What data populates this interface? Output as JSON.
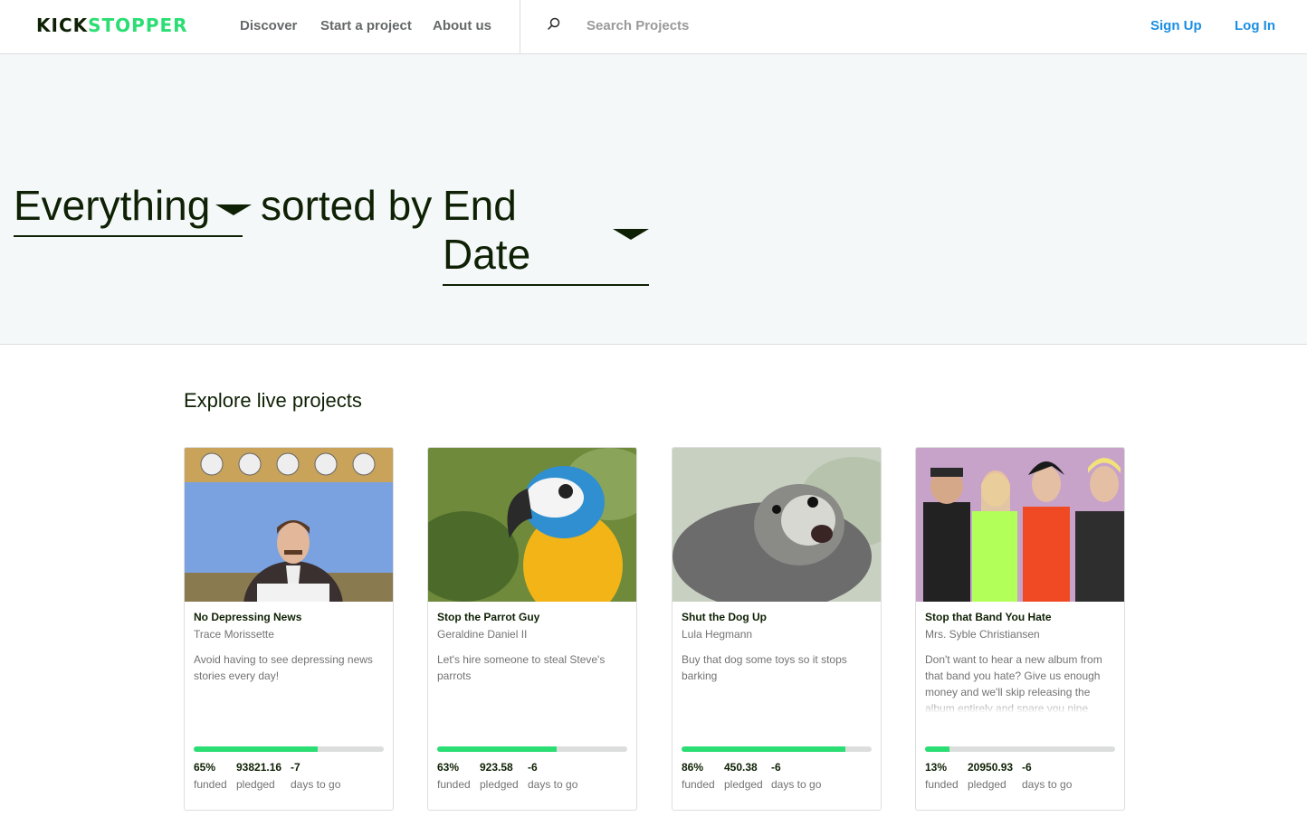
{
  "header": {
    "logo_part1": "KICK",
    "logo_part2": "STOPPER",
    "nav": [
      "Discover",
      "Start a project",
      "About us"
    ],
    "search_placeholder": "Search Projects",
    "sign_up": "Sign Up",
    "log_in": "Log In"
  },
  "hero": {
    "category": "Everything",
    "middle_text": "sorted by",
    "sort": "End Date"
  },
  "section_title": "Explore live projects",
  "projects": [
    {
      "title": "No Depressing News",
      "creator": "Trace Morissette",
      "description": "Avoid having to see depressing news stories every day!",
      "funded_percent": 65,
      "funded": "65%",
      "funded_label": "funded",
      "pledged": "93821.16",
      "pledged_label": "pledged",
      "days": "-7",
      "days_label": "days to go",
      "image_icon": "news-anchor-photo"
    },
    {
      "title": "Stop the Parrot Guy",
      "creator": "Geraldine Daniel II",
      "description": "Let's hire someone to steal Steve's parrots",
      "funded_percent": 63,
      "funded": "63%",
      "funded_label": "funded",
      "pledged": "923.58",
      "pledged_label": "pledged",
      "days": "-6",
      "days_label": "days to go",
      "image_icon": "parrot-photo"
    },
    {
      "title": "Shut the Dog Up",
      "creator": "Lula Hegmann",
      "description": "Buy that dog some toys so it stops barking",
      "funded_percent": 86,
      "funded": "86%",
      "funded_label": "funded",
      "pledged": "450.38",
      "pledged_label": "pledged",
      "days": "-6",
      "days_label": "days to go",
      "image_icon": "barking-dog-photo"
    },
    {
      "title": "Stop that Band You Hate",
      "creator": "Mrs. Syble Christiansen",
      "description": "Don't want to hear a new album from that band you hate? Give us enough money and we'll skip releasing the album entirely and spare you nine",
      "funded_percent": 13,
      "funded": "13%",
      "funded_label": "funded",
      "pledged": "20950.93",
      "pledged_label": "pledged",
      "days": "-6",
      "days_label": "days to go",
      "image_icon": "band-photo"
    }
  ],
  "colors": {
    "brand_green": "#2bde73",
    "brand_dark": "#0f2105",
    "link_blue": "#1a8fe3",
    "hero_bg": "#f5f8f8"
  }
}
